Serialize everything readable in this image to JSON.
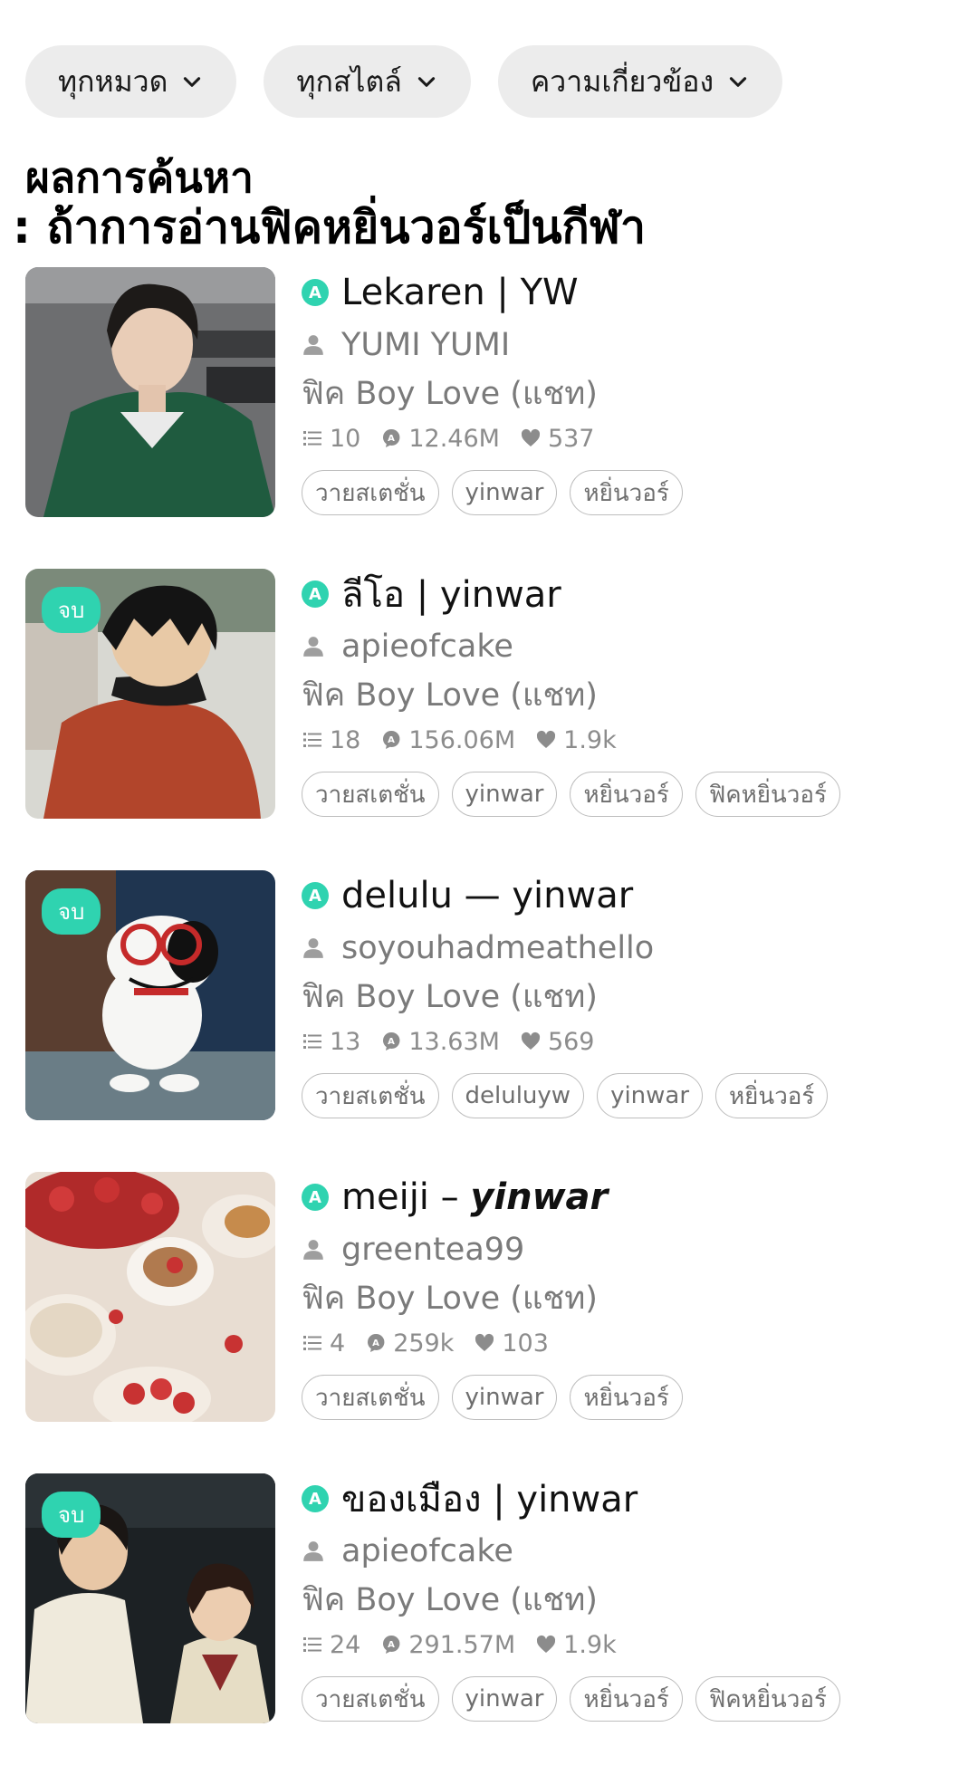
{
  "filters": [
    {
      "label": "ทุกหมวด"
    },
    {
      "label": "ทุกสไตล์"
    },
    {
      "label": "ความเกี่ยวข้อง"
    }
  ],
  "heading": {
    "line1": "ผลการค้นหา",
    "line2": ": ถ้าการอ่านฟิคหยิ่นวอร์เป็นกีฬา"
  },
  "end_badge": "จบ",
  "results": [
    {
      "title": "Lekaren | YW",
      "author": "YUMI YUMI",
      "category": "ฟิค Boy Love (แชท)",
      "chapters": "10",
      "views": "12.46M",
      "likes": "537",
      "tags": [
        "วายสเตชั่น",
        "yinwar",
        "หยิ่นวอร์"
      ]
    },
    {
      "title": "ลีโอ | yinwar",
      "author": "apieofcake",
      "category": "ฟิค Boy Love (แชท)",
      "chapters": "18",
      "views": "156.06M",
      "likes": "1.9k",
      "tags": [
        "วายสเตชั่น",
        "yinwar",
        "หยิ่นวอร์",
        "ฟิคหยิ่นวอร์"
      ]
    },
    {
      "title": "delulu — yinwar",
      "author": "soyouhadmeathello",
      "category": "ฟิค Boy Love (แชท)",
      "chapters": "13",
      "views": "13.63M",
      "likes": "569",
      "tags": [
        "วายสเตชั่น",
        "deluluyw",
        "yinwar",
        "หยิ่นวอร์"
      ]
    },
    {
      "title_plain": "meiji – ",
      "title_em": "yinwar",
      "author": "greentea99",
      "category": "ฟิค Boy Love (แชท)",
      "chapters": "4",
      "views": "259k",
      "likes": "103",
      "tags": [
        "วายสเตชั่น",
        "yinwar",
        "หยิ่นวอร์"
      ]
    },
    {
      "title": "ของเมือง | yinwar",
      "author": "apieofcake",
      "category": "ฟิค Boy Love (แชท)",
      "chapters": "24",
      "views": "291.57M",
      "likes": "1.9k",
      "tags": [
        "วายสเตชั่น",
        "yinwar",
        "หยิ่นวอร์",
        "ฟิคหยิ่นวอร์"
      ]
    }
  ],
  "colors": {
    "accent": "#2fd3b0",
    "chip_bg": "#ececec",
    "muted_text": "#7a7a7a"
  }
}
